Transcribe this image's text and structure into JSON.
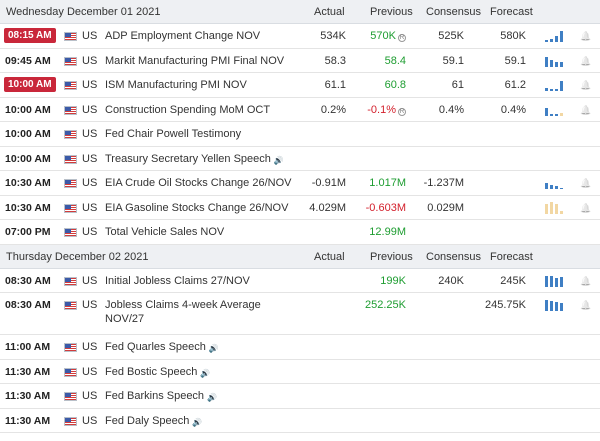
{
  "days": [
    {
      "date": "Wednesday December 01 2021",
      "headers": {
        "actual": "Actual",
        "previous": "Previous",
        "consensus": "Consensus",
        "forecast": "Forecast"
      },
      "events": [
        {
          "time": "08:15 AM",
          "live": true,
          "country": "US",
          "event": "ADP Employment Change NOV",
          "actual": "534K",
          "previous": "570K",
          "previous_color": "green",
          "previous_revised": true,
          "consensus": "525K",
          "forecast": "580K",
          "chart": [
            2,
            3,
            6,
            11
          ],
          "alert": true
        },
        {
          "time": "09:45 AM",
          "live": false,
          "country": "US",
          "event": "Markit Manufacturing PMI Final NOV",
          "actual": "58.3",
          "previous": "58.4",
          "previous_color": "green",
          "consensus": "59.1",
          "forecast": "59.1",
          "chart": [
            10,
            7,
            5,
            5
          ],
          "alert": true
        },
        {
          "time": "10:00 AM",
          "live": true,
          "country": "US",
          "event": "ISM Manufacturing PMI NOV",
          "actual": "61.1",
          "previous": "60.8",
          "previous_color": "green",
          "consensus": "61",
          "forecast": "61.2",
          "chart": [
            3,
            2,
            2,
            10
          ],
          "alert": true
        },
        {
          "time": "10:00 AM",
          "live": false,
          "country": "US",
          "event": "Construction Spending MoM OCT",
          "actual": "0.2%",
          "previous": "-0.1%",
          "previous_color": "red",
          "previous_revised": true,
          "consensus": "0.4%",
          "forecast": "0.4%",
          "chart": [
            8,
            2,
            2,
            0
          ],
          "chart_yellow": true,
          "alert": true
        },
        {
          "time": "10:00 AM",
          "live": false,
          "country": "US",
          "event": "Fed Chair Powell Testimony",
          "actual": "",
          "previous": "",
          "consensus": "",
          "forecast": "",
          "chart": [],
          "alert": false
        },
        {
          "time": "10:00 AM",
          "live": false,
          "country": "US",
          "event": "Treasury Secretary Yellen Speech",
          "speech": true,
          "actual": "",
          "previous": "",
          "consensus": "",
          "forecast": "",
          "chart": [],
          "alert": false
        },
        {
          "time": "10:30 AM",
          "live": false,
          "country": "US",
          "event": "EIA Crude Oil Stocks Change 26/NOV",
          "actual": "-0.91M",
          "previous": "1.017M",
          "previous_color": "green",
          "consensus": "-1.237M",
          "forecast": "",
          "chart": [
            6,
            4,
            3,
            0
          ],
          "alert": true
        },
        {
          "time": "10:30 AM",
          "live": false,
          "country": "US",
          "event": "EIA Gasoline Stocks Change 26/NOV",
          "actual": "4.029M",
          "previous": "-0.603M",
          "previous_color": "red",
          "consensus": "0.029M",
          "forecast": "",
          "chart": [
            10,
            12,
            10,
            3
          ],
          "chart_yellow_all": true,
          "alert": true
        },
        {
          "time": "07:00 PM",
          "live": false,
          "country": "US",
          "event": "Total Vehicle Sales NOV",
          "actual": "",
          "previous": "12.99M",
          "previous_color": "green",
          "consensus": "",
          "forecast": "",
          "chart": [],
          "alert": false
        }
      ]
    },
    {
      "date": "Thursday December 02 2021",
      "headers": {
        "actual": "Actual",
        "previous": "Previous",
        "consensus": "Consensus",
        "forecast": "Forecast"
      },
      "events": [
        {
          "time": "08:30 AM",
          "live": false,
          "country": "US",
          "event": "Initial Jobless Claims 27/NOV",
          "actual": "",
          "previous": "199K",
          "previous_color": "green",
          "consensus": "240K",
          "forecast": "245K",
          "chart": [
            11,
            11,
            9,
            10
          ],
          "alert": true
        },
        {
          "time": "08:30 AM",
          "live": false,
          "country": "US",
          "event": "Jobless Claims 4-week Average NOV/27",
          "tall": true,
          "actual": "",
          "previous": "252.25K",
          "previous_color": "green",
          "consensus": "",
          "forecast": "245.75K",
          "chart": [
            11,
            10,
            9,
            8
          ],
          "alert": true
        },
        {
          "time": "11:00 AM",
          "live": false,
          "country": "US",
          "event": "Fed Quarles Speech",
          "speech": true,
          "actual": "",
          "previous": "",
          "consensus": "",
          "forecast": "",
          "chart": [],
          "alert": false
        },
        {
          "time": "11:30 AM",
          "live": false,
          "country": "US",
          "event": "Fed Bostic Speech",
          "speech": true,
          "actual": "",
          "previous": "",
          "consensus": "",
          "forecast": "",
          "chart": [],
          "alert": false
        },
        {
          "time": "11:30 AM",
          "live": false,
          "country": "US",
          "event": "Fed Barkins Speech",
          "speech": true,
          "actual": "",
          "previous": "",
          "consensus": "",
          "forecast": "",
          "chart": [],
          "alert": false
        },
        {
          "time": "11:30 AM",
          "live": false,
          "country": "US",
          "event": "Fed Daly Speech",
          "speech": true,
          "actual": "",
          "previous": "",
          "consensus": "",
          "forecast": "",
          "chart": [],
          "alert": false
        }
      ]
    }
  ],
  "icons": {
    "flag": "us-flag-icon",
    "speech": "speaker-icon",
    "alert": "bell-icon",
    "revised": "revised-marker-icon"
  },
  "colors": {
    "live_badge": "#c9273a",
    "positive": "#1e9d31",
    "negative": "#d3202c",
    "chart_bar": "#3f7fc4",
    "chart_bar_alt": "#f2d7a3",
    "header_bg": "#eef0f3"
  }
}
